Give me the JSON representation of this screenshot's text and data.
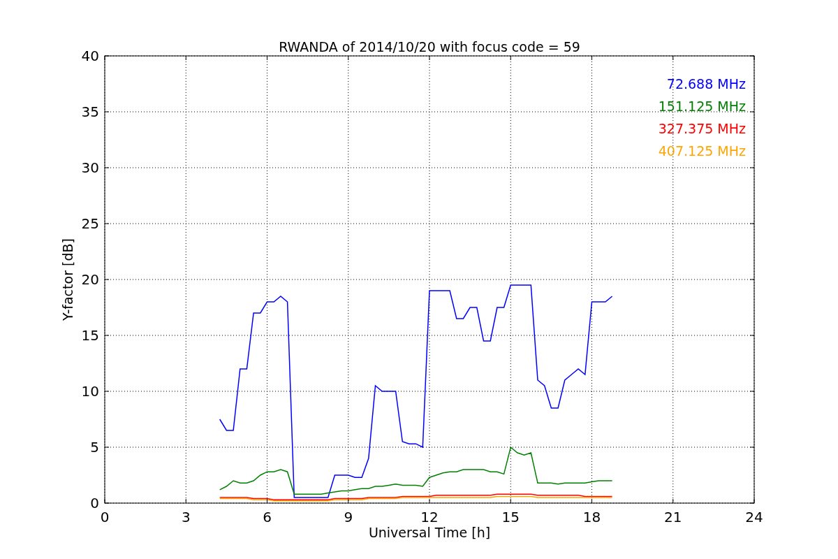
{
  "figure": {
    "chart_data": {
      "type": "line",
      "title": "RWANDA of 2014/10/20 with focus code = 59",
      "xlabel": "Universal Time [h]",
      "ylabel": "Y-factor [dB]",
      "grid": true,
      "xlim": [
        0,
        24
      ],
      "ylim": [
        0,
        40
      ],
      "xticks": [
        0,
        3,
        6,
        9,
        12,
        15,
        18,
        21,
        24
      ],
      "yticks": [
        0,
        5,
        10,
        15,
        20,
        25,
        30,
        35,
        40
      ],
      "x": [
        4.25,
        4.5,
        4.75,
        5,
        5.25,
        5.5,
        5.75,
        6,
        6.25,
        6.5,
        6.75,
        7,
        7.25,
        7.5,
        7.75,
        8,
        8.25,
        8.5,
        8.75,
        9,
        9.25,
        9.5,
        9.75,
        10,
        10.25,
        10.5,
        10.75,
        11,
        11.25,
        11.5,
        11.75,
        12,
        12.25,
        12.5,
        12.75,
        13,
        13.25,
        13.5,
        13.75,
        14,
        14.25,
        14.5,
        14.75,
        15,
        15.25,
        15.5,
        15.75,
        16,
        16.25,
        16.5,
        16.75,
        17,
        17.25,
        17.5,
        17.75,
        18,
        18.25,
        18.5,
        18.75
      ],
      "series": [
        {
          "name": "72.688 MHz",
          "color": "#0000ff",
          "values": [
            7.5,
            6.5,
            6.5,
            12,
            12,
            17,
            17,
            18,
            18,
            18.5,
            18,
            0.5,
            0.5,
            0.5,
            0.5,
            0.5,
            0.5,
            2.5,
            2.5,
            2.5,
            2.3,
            2.3,
            4,
            10.5,
            10,
            10,
            10,
            5.5,
            5.3,
            5.3,
            5,
            19,
            19,
            19,
            19,
            16.5,
            16.5,
            17.5,
            17.5,
            14.5,
            14.5,
            17.5,
            17.5,
            19.5,
            19.5,
            19.5,
            19.5,
            11,
            10.5,
            8.5,
            8.5,
            11,
            11.5,
            12,
            11.5,
            18,
            18,
            18,
            18.5
          ]
        },
        {
          "name": "151.125 MHz",
          "color": "#008000",
          "values": [
            1.2,
            1.5,
            2,
            1.8,
            1.8,
            2,
            2.5,
            2.8,
            2.8,
            3,
            2.8,
            0.8,
            0.8,
            0.8,
            0.8,
            0.8,
            0.9,
            1.0,
            1.1,
            1.1,
            1.2,
            1.3,
            1.3,
            1.5,
            1.5,
            1.6,
            1.7,
            1.6,
            1.6,
            1.6,
            1.5,
            2.3,
            2.5,
            2.7,
            2.8,
            2.8,
            3,
            3,
            3,
            3,
            2.8,
            2.8,
            2.6,
            5,
            4.5,
            4.3,
            4.5,
            1.8,
            1.8,
            1.8,
            1.7,
            1.8,
            1.8,
            1.8,
            1.8,
            1.9,
            2,
            2,
            2
          ]
        },
        {
          "name": "327.375 MHz",
          "color": "#ff0000",
          "values": [
            0.5,
            0.5,
            0.5,
            0.5,
            0.5,
            0.4,
            0.4,
            0.4,
            0.3,
            0.3,
            0.3,
            0.3,
            0.3,
            0.3,
            0.3,
            0.3,
            0.3,
            0.4,
            0.4,
            0.4,
            0.4,
            0.4,
            0.5,
            0.5,
            0.5,
            0.5,
            0.5,
            0.6,
            0.6,
            0.6,
            0.6,
            0.6,
            0.7,
            0.7,
            0.7,
            0.7,
            0.7,
            0.7,
            0.7,
            0.7,
            0.7,
            0.8,
            0.8,
            0.8,
            0.8,
            0.8,
            0.8,
            0.7,
            0.7,
            0.7,
            0.7,
            0.7,
            0.7,
            0.7,
            0.6,
            0.6,
            0.6,
            0.6,
            0.6
          ]
        },
        {
          "name": "407.125 MHz",
          "color": "#ffa500",
          "values": [
            0.4,
            0.4,
            0.4,
            0.4,
            0.4,
            0.3,
            0.3,
            0.3,
            0.2,
            0.2,
            0.2,
            0.2,
            0.2,
            0.2,
            0.2,
            0.2,
            0.2,
            0.3,
            0.3,
            0.3,
            0.3,
            0.3,
            0.4,
            0.4,
            0.4,
            0.4,
            0.4,
            0.5,
            0.5,
            0.5,
            0.5,
            0.5,
            0.5,
            0.5,
            0.5,
            0.5,
            0.5,
            0.5,
            0.5,
            0.5,
            0.5,
            0.6,
            0.6,
            0.6,
            0.6,
            0.6,
            0.6,
            0.5,
            0.5,
            0.5,
            0.5,
            0.5,
            0.5,
            0.5,
            0.5,
            0.5,
            0.5,
            0.5,
            0.5
          ]
        }
      ]
    }
  }
}
